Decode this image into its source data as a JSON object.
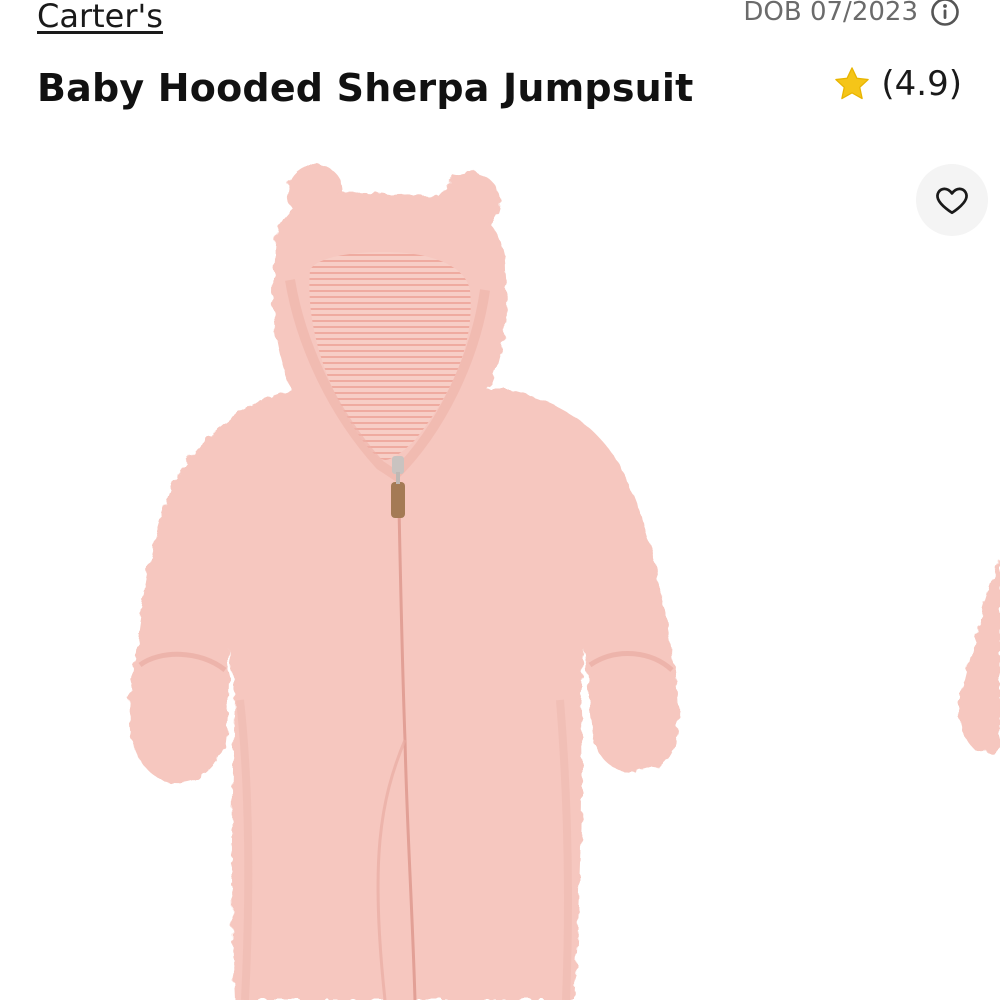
{
  "header": {
    "brand": "Carter's",
    "dob_label": "DOB 07/2023",
    "info_icon": "info-circle-icon"
  },
  "product": {
    "title": "Baby Hooded Sherpa Jumpsuit",
    "rating_text": "(4.9)",
    "rating_icon": "star-icon",
    "favorite_icon": "heart-outline-icon"
  },
  "colors": {
    "star": "#f5c518",
    "garment": "#f6c7bf",
    "garment_shadow": "#e9ada3",
    "lining": "#f3b3a8"
  }
}
